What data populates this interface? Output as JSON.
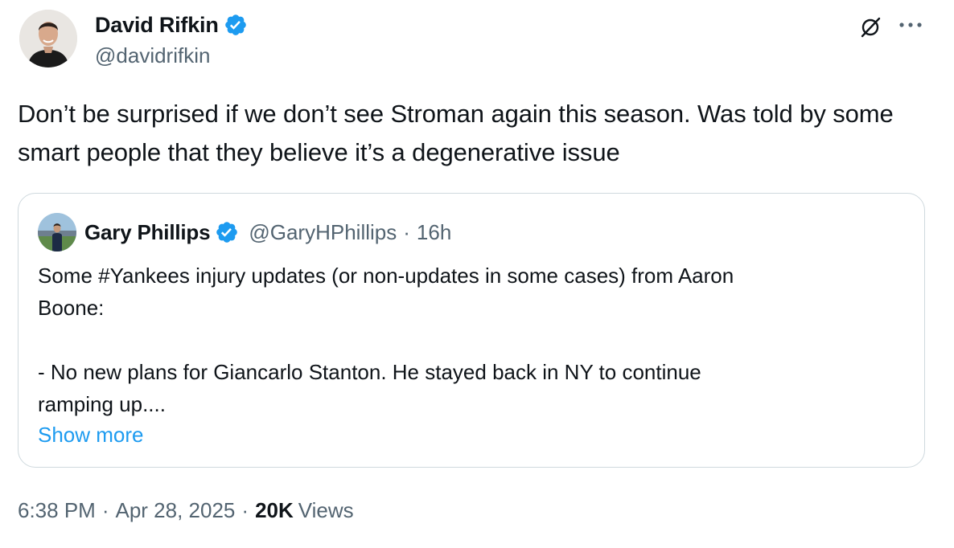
{
  "colors": {
    "text_primary": "#0f1419",
    "text_secondary": "#536471",
    "link": "#1d9bf0",
    "verified_badge": "#1d9bf0",
    "card_border": "#cfd9de"
  },
  "tweet": {
    "author": {
      "name": "David Rifkin",
      "handle": "@davidrifkin",
      "verified": true,
      "avatar_icon": "profile-photo"
    },
    "actions": {
      "grok_icon": "grok-icon",
      "more_icon": "more-horizontal-icon"
    },
    "text": "Don’t be surprised if we don’t see Stroman again this season. Was told by some smart people that they believe it’s a degenerative issue",
    "quote": {
      "author_name": "Gary Phillips",
      "author_handle": "@GaryHPhillips",
      "separator": "·",
      "time": "16h",
      "verified": true,
      "lines": [
        "Some #Yankees injury updates (or non-updates in some cases) from Aaron",
        "Boone:",
        "",
        "- No new plans for Giancarlo Stanton. He stayed back in NY to continue",
        "ramping up...."
      ],
      "show_more": "Show more"
    },
    "meta": {
      "time": "6:38 PM",
      "date": "Apr 28, 2025",
      "separator": "·",
      "views_count": "20K",
      "views_label": "Views"
    }
  }
}
